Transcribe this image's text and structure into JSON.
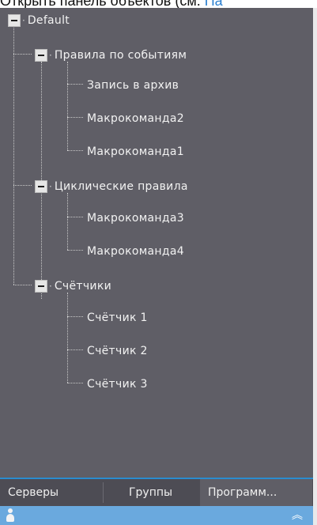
{
  "caption": {
    "text": "Открыть панель объектов (см. ",
    "link": "Па"
  },
  "tree": {
    "root": "Default",
    "groups": [
      {
        "label": "Правила по событиям",
        "items": [
          "Запись в архив",
          "Макрокоманда2",
          "Макрокоманда1"
        ]
      },
      {
        "label": "Циклические правила",
        "items": [
          "Макрокоманда3",
          "Макрокоманда4"
        ]
      },
      {
        "label": "Счётчики",
        "items": [
          "Счётчик 1",
          "Счётчик 2",
          "Счётчик 3"
        ]
      }
    ]
  },
  "tabs": {
    "servers": "Серверы",
    "groups": "Группы",
    "programs": "Программ..."
  },
  "statusbar": {
    "user_icon": "user-icon",
    "collapse_icon": "double-chevron-up-icon",
    "collapse_glyph": "︽"
  },
  "colors": {
    "panel": "#5f5e66",
    "accent": "#2a8ccf",
    "statusbar": "#6aa9de"
  }
}
